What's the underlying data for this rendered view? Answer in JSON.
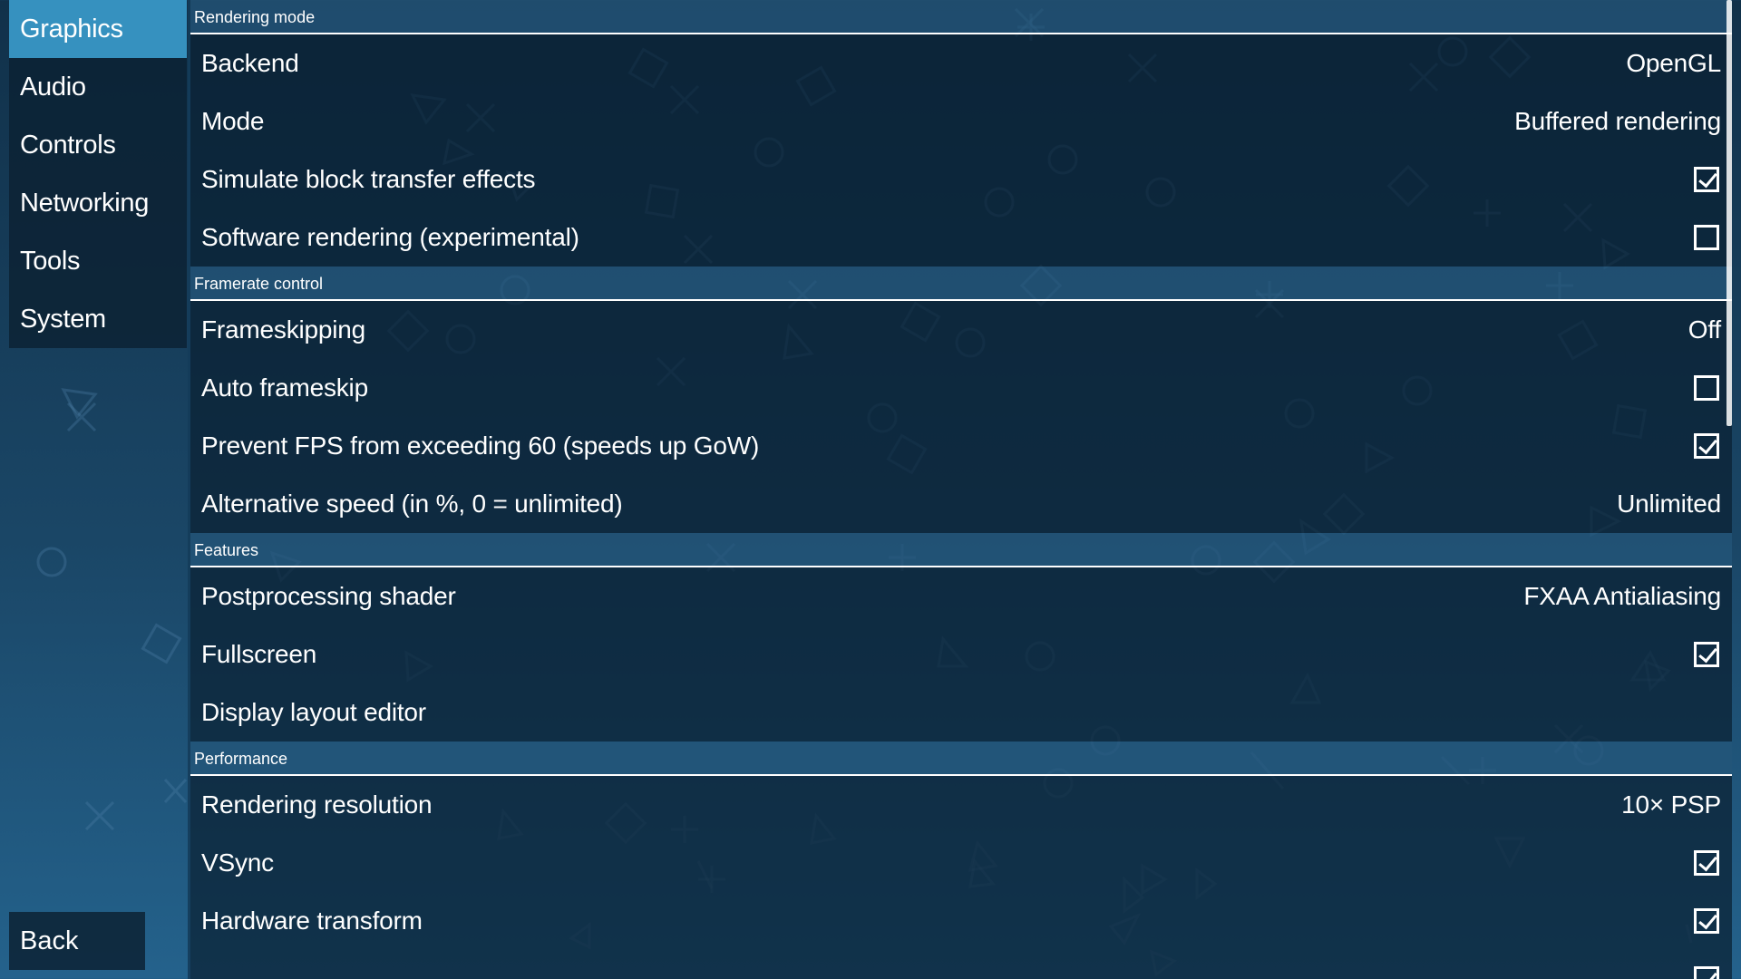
{
  "nav": {
    "items": [
      {
        "label": "Graphics",
        "active": true
      },
      {
        "label": "Audio",
        "active": false
      },
      {
        "label": "Controls",
        "active": false
      },
      {
        "label": "Networking",
        "active": false
      },
      {
        "label": "Tools",
        "active": false
      },
      {
        "label": "System",
        "active": false
      }
    ],
    "back_label": "Back"
  },
  "sections": {
    "rendering_mode": {
      "header": "Rendering mode",
      "backend": {
        "label": "Backend",
        "value": "OpenGL"
      },
      "mode": {
        "label": "Mode",
        "value": "Buffered rendering"
      },
      "simulate_block": {
        "label": "Simulate block transfer effects",
        "checked": true
      },
      "software_rendering": {
        "label": "Software rendering (experimental)",
        "checked": false
      }
    },
    "framerate_control": {
      "header": "Framerate control",
      "frameskipping": {
        "label": "Frameskipping",
        "value": "Off"
      },
      "auto_frameskip": {
        "label": "Auto frameskip",
        "checked": false
      },
      "prevent_fps": {
        "label": "Prevent FPS from exceeding 60 (speeds up GoW)",
        "checked": true
      },
      "alt_speed": {
        "label": "Alternative speed (in %, 0 = unlimited)",
        "value": "Unlimited"
      }
    },
    "features": {
      "header": "Features",
      "postprocessing": {
        "label": "Postprocessing shader",
        "value": "FXAA Antialiasing"
      },
      "fullscreen": {
        "label": "Fullscreen",
        "checked": true
      },
      "layout_editor": {
        "label": "Display layout editor"
      }
    },
    "performance": {
      "header": "Performance",
      "resolution": {
        "label": "Rendering resolution",
        "value": "10× PSP"
      },
      "vsync": {
        "label": "VSync",
        "checked": true
      },
      "hw_transform": {
        "label": "Hardware transform",
        "checked": true
      }
    }
  },
  "colors": {
    "active_tab": "#3691bf",
    "background_top": "#11314a",
    "background_bottom": "#24628c"
  }
}
